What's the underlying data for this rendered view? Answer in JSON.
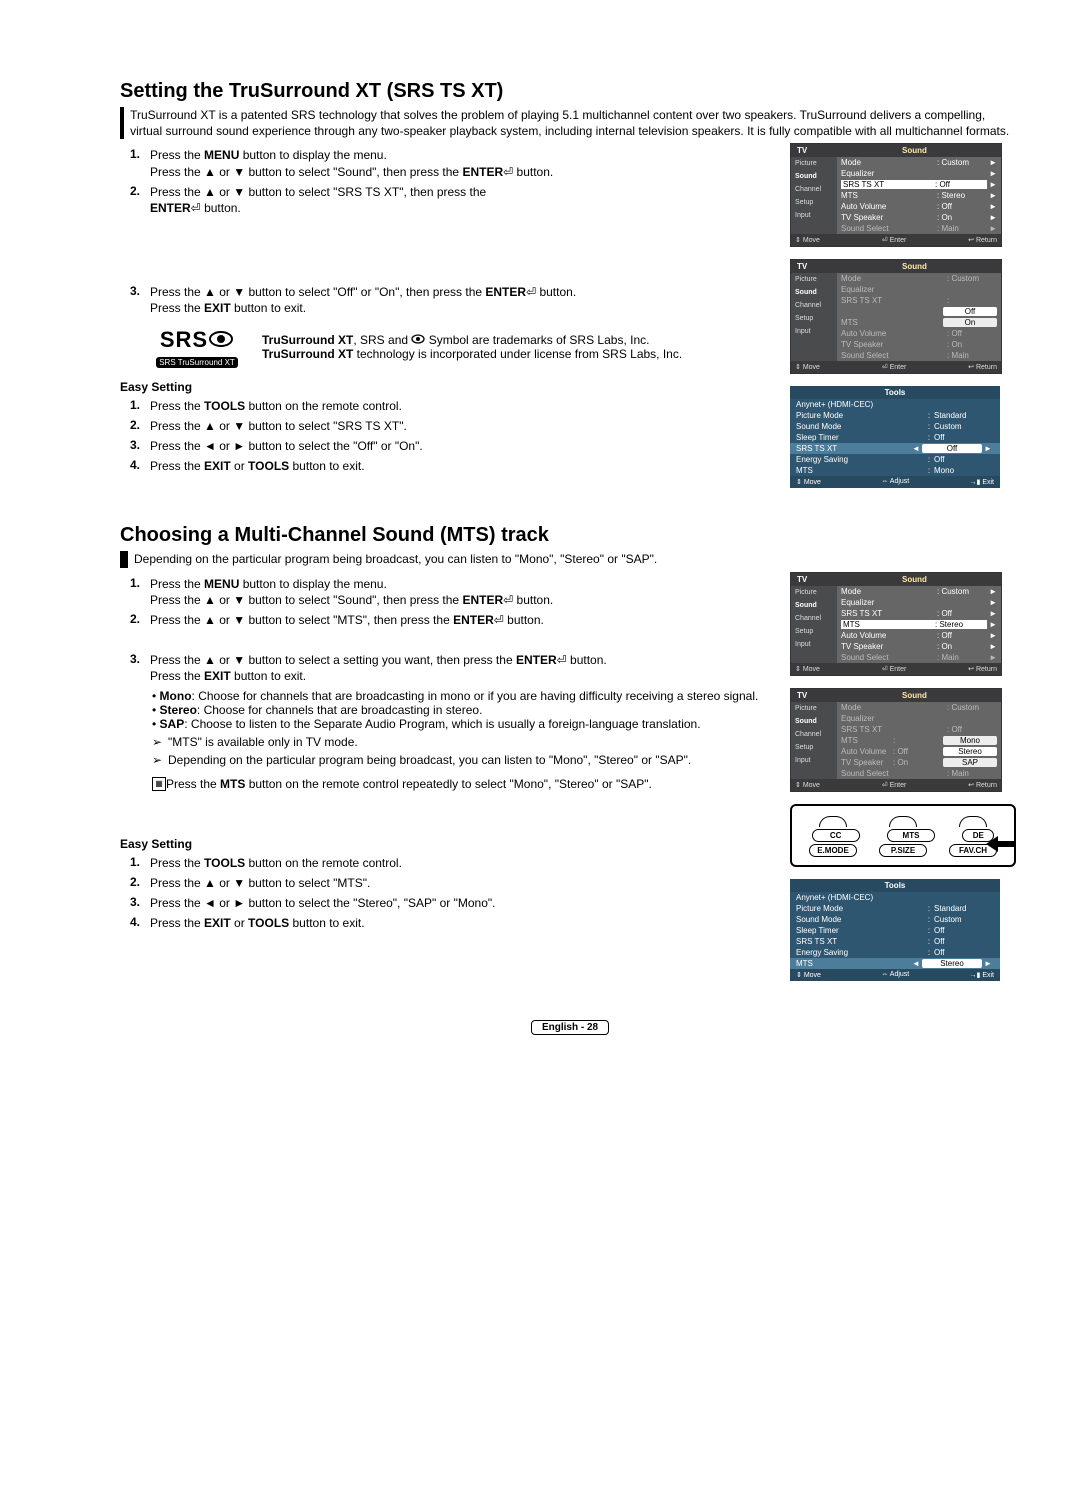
{
  "section1": {
    "title": "Setting the TruSurround XT (SRS TS XT)",
    "intro": "TruSurround XT is a patented SRS technology that solves the problem of playing 5.1 multichannel content over two speakers. TruSurround delivers a compelling, virtual surround sound experience through any two-speaker playback system, including internal television speakers. It is fully compatible with all multichannel formats.",
    "step1a": "Press the ",
    "step1a_bold": "MENU",
    "step1a_end": " button to display the menu.",
    "step1b": "Press the ▲ or ▼ button to select \"Sound\", then press the ",
    "step1b_bold": "ENTER",
    "step1b_end": " button.",
    "step2": "Press the ▲ or ▼ button to select \"SRS TS XT\", then press the ",
    "step2_bold": "ENTER",
    "step2_end": " button.",
    "step3a": "Press the ▲ or ▼ button to select \"Off\" or \"On\", then press the ",
    "step3a_bold": "ENTER",
    "step3a_end": " button.",
    "step3b": "Press the ",
    "step3b_bold": "EXIT",
    "step3b_end": " button to exit.",
    "srs_logo": "SRS",
    "srs_pill": "SRS TruSurround XT",
    "srs_tm1_a": "TruSurround XT",
    "srs_tm1_b": ", SRS and ",
    "srs_tm1_c": " Symbol are trademarks of SRS Labs, Inc.",
    "srs_tm2_a": "TruSurround XT",
    "srs_tm2_b": " technology is incorporated under license from SRS Labs, Inc.",
    "easy_heading": "Easy Setting",
    "easy1": "Press the ",
    "easy1_bold": "TOOLS",
    "easy1_end": " button on the remote control.",
    "easy2": "Press the ▲ or ▼ button to select \"SRS TS XT\".",
    "easy3": "Press the ◄ or ► button to select the \"Off\" or \"On\".",
    "easy4": "Press the ",
    "easy4_bold1": "EXIT",
    "easy4_mid": " or ",
    "easy4_bold2": "TOOLS",
    "easy4_end": " button to exit."
  },
  "section2": {
    "title": "Choosing a Multi-Channel Sound (MTS) track",
    "intro": "Depending on the particular program being broadcast, you can listen to \"Mono\", \"Stereo\" or \"SAP\".",
    "step1a": "Press the ",
    "step1a_bold": "MENU",
    "step1a_end": " button to display the menu.",
    "step1b": "Press the ▲ or ▼ button to select \"Sound\", then press the ",
    "step1b_bold": "ENTER",
    "step1b_end": " button.",
    "step2": "Press the ▲ or ▼ button to select \"MTS\", then press the ",
    "step2_bold": "ENTER",
    "step2_end": " button.",
    "step3a": "Press the ▲ or ▼ button to select a setting you want, then press the ",
    "step3a_bold": "ENTER",
    "step3a_end": " button.",
    "step3b": "Press the ",
    "step3b_bold": "EXIT",
    "step3b_end": " button to exit.",
    "bullet_mono_a": "Mono",
    "bullet_mono_b": ": Choose for channels that are broadcasting in mono or if you are having difficulty receiving a stereo signal.",
    "bullet_stereo_a": "Stereo",
    "bullet_stereo_b": ": Choose for channels that are broadcasting in stereo.",
    "bullet_sap_a": "SAP",
    "bullet_sap_b": ": Choose to listen to the Separate Audio Program, which is usually a foreign-language translation.",
    "note1": "\"MTS\" is available only in TV mode.",
    "note2": "Depending on the particular program being broadcast, you can listen to \"Mono\", \"Stereo\" or \"SAP\".",
    "remote_note_a": "Press the ",
    "remote_note_bold": "MTS",
    "remote_note_b": " button on the remote control repeatedly to select \"Mono\", \"Stereo\" or \"SAP\".",
    "easy_heading": "Easy Setting",
    "easy1": "Press the ",
    "easy1_bold": "TOOLS",
    "easy1_end": " button on the remote control.",
    "easy2": "Press the ▲ or ▼ button to select \"MTS\".",
    "easy3": "Press the ◄ or ► button to select the \"Stereo\", \"SAP\" or  \"Mono\".",
    "easy4": "Press the ",
    "easy4_bold1": "EXIT",
    "easy4_mid": " or ",
    "easy4_bold2": "TOOLS",
    "easy4_end": " button to exit."
  },
  "osd_common": {
    "tv": "TV",
    "sound": "Sound",
    "side": {
      "picture": "Picture",
      "sound": "Sound",
      "channel": "Channel",
      "setup": "Setup",
      "input": "Input"
    },
    "foot_move": "Move",
    "foot_enter": "Enter",
    "foot_return": "Return",
    "rows": {
      "mode": "Mode",
      "equalizer": "Equalizer",
      "srs": "SRS TS XT",
      "mts": "MTS",
      "autovol": "Auto Volume",
      "tvspeak": "TV Speaker",
      "soundsel": "Sound Select"
    },
    "vals": {
      "custom": ": Custom",
      "off": ": Off",
      "stereo": ": Stereo",
      "on": ": On",
      "main": ": Main"
    }
  },
  "osd1b": {
    "srs_val_off": "Off",
    "srs_val_on": "On"
  },
  "osd2b": {
    "mts_mono": "Mono",
    "mts_stereo": "Stereo",
    "mts_sap": "SAP"
  },
  "tools1": {
    "title": "Tools",
    "anynet": "Anynet+ (HDMI-CEC)",
    "rows": [
      {
        "k": "Picture Mode",
        "v": "Standard"
      },
      {
        "k": "Sound Mode",
        "v": "Custom"
      },
      {
        "k": "Sleep Timer",
        "v": "Off"
      }
    ],
    "hil": {
      "k": "SRS TS XT",
      "v": "Off"
    },
    "rows2": [
      {
        "k": "Energy Saving",
        "v": "Off"
      },
      {
        "k": "MTS",
        "v": "Mono"
      }
    ],
    "foot_move": "Move",
    "foot_adjust": "Adjust",
    "foot_exit": "Exit"
  },
  "tools2": {
    "title": "Tools",
    "anynet": "Anynet+ (HDMI-CEC)",
    "rows": [
      {
        "k": "Picture Mode",
        "v": "Standard"
      },
      {
        "k": "Sound Mode",
        "v": "Custom"
      },
      {
        "k": "Sleep Timer",
        "v": "Off"
      },
      {
        "k": "SRS TS XT",
        "v": "Off"
      },
      {
        "k": "Energy Saving",
        "v": "Off"
      }
    ],
    "hil": {
      "k": "MTS",
      "v": "Stereo"
    },
    "foot_move": "Move",
    "foot_adjust": "Adjust",
    "foot_exit": "Exit"
  },
  "remote": {
    "top": [
      "CC",
      "MTS",
      "DE"
    ],
    "bot": [
      "E.MODE",
      "P.SIZE",
      "FAV.CH"
    ]
  },
  "footer": "English - 28",
  "glyphs": {
    "enter_icon": "⏎",
    "move": "⇕",
    "adjust": "⇔",
    "ret": "↩",
    "tri": "►",
    "note": "➢",
    "remote_icon": "⎙"
  }
}
